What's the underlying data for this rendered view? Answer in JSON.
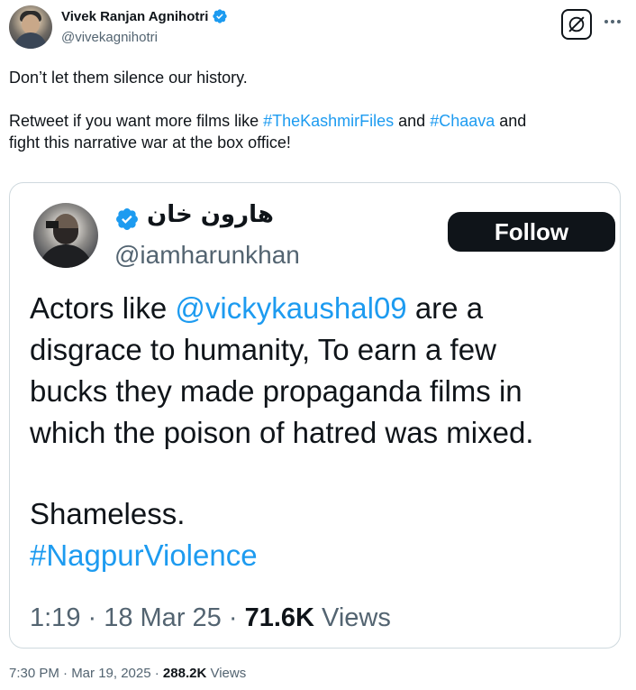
{
  "author": {
    "name": "Vivek Ranjan Agnihotri",
    "handle": "@vivekagnihotri",
    "verified_color": "#1d9bf0"
  },
  "tweet": {
    "line1": "Don’t let them silence our history.",
    "line2_prefix": "Retweet if you want more films like ",
    "hashtag1": "#TheKashmirFiles",
    "line2_middle": " and ",
    "hashtag2": "#Chaava",
    "line2_suffix": " and",
    "line3": "fight this narrative war at the box office!"
  },
  "quote": {
    "name": "هارون خان",
    "handle": "@iamharunkhan",
    "follow_label": "Follow",
    "text_prefix": "Actors like ",
    "mention": "@vickykaushal09",
    "text_line1_suffix": " are a",
    "text_line2": "disgrace to humanity, To earn a few",
    "text_line3": "bucks they made propaganda films in",
    "text_line4": "which the poison of hatred was mixed.",
    "text_line5": "Shameless.",
    "hashtag": "#NagpurViolence",
    "time": "1:19 · 18 Mar 25 · ",
    "views_count": "71.6K",
    "views_label": " Views"
  },
  "footer": {
    "timestamp": "7:30 PM · Mar 19, 2025 · ",
    "views_count": "288.2K",
    "views_label": " Views"
  },
  "icons": {
    "grok": "grok-icon",
    "more": "more-icon",
    "verified": "verified-badge-icon"
  },
  "colors": {
    "link": "#1d9bf0",
    "text": "#0f1419",
    "muted": "#536471",
    "border": "#cfd9de"
  }
}
